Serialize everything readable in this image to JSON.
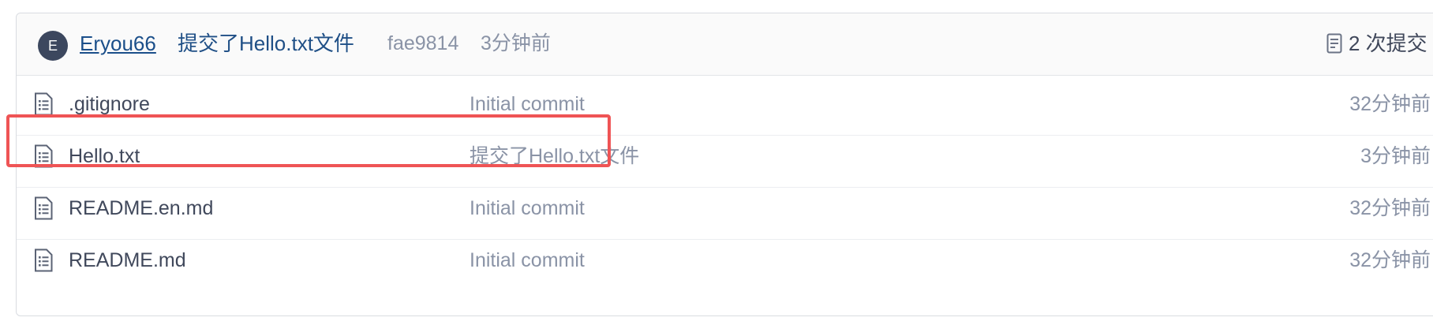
{
  "commit": {
    "avatar_letter": "E",
    "author": " Eryou66",
    "message": "提交了Hello.txt文件",
    "sha": "fae9814",
    "time": "3分钟前",
    "count_label": "2 次提交"
  },
  "files": [
    {
      "name": ".gitignore",
      "commit": "Initial commit",
      "time": "32分钟前",
      "icon": "file-list-icon"
    },
    {
      "name": "Hello.txt",
      "commit": "提交了Hello.txt文件",
      "time": "3分钟前",
      "icon": "file-list-icon"
    },
    {
      "name": "README.en.md",
      "commit": "Initial commit",
      "time": "32分钟前",
      "icon": "file-list-icon"
    },
    {
      "name": "README.md",
      "commit": "Initial commit",
      "time": "32分钟前",
      "icon": "file-list-icon"
    }
  ],
  "highlight": {
    "target": "Hello.txt",
    "color": "#ef5455"
  },
  "colors": {
    "link": "#1b4f8a",
    "muted": "#8a93a6",
    "text": "#40485b",
    "avatar": "#3c475e"
  }
}
